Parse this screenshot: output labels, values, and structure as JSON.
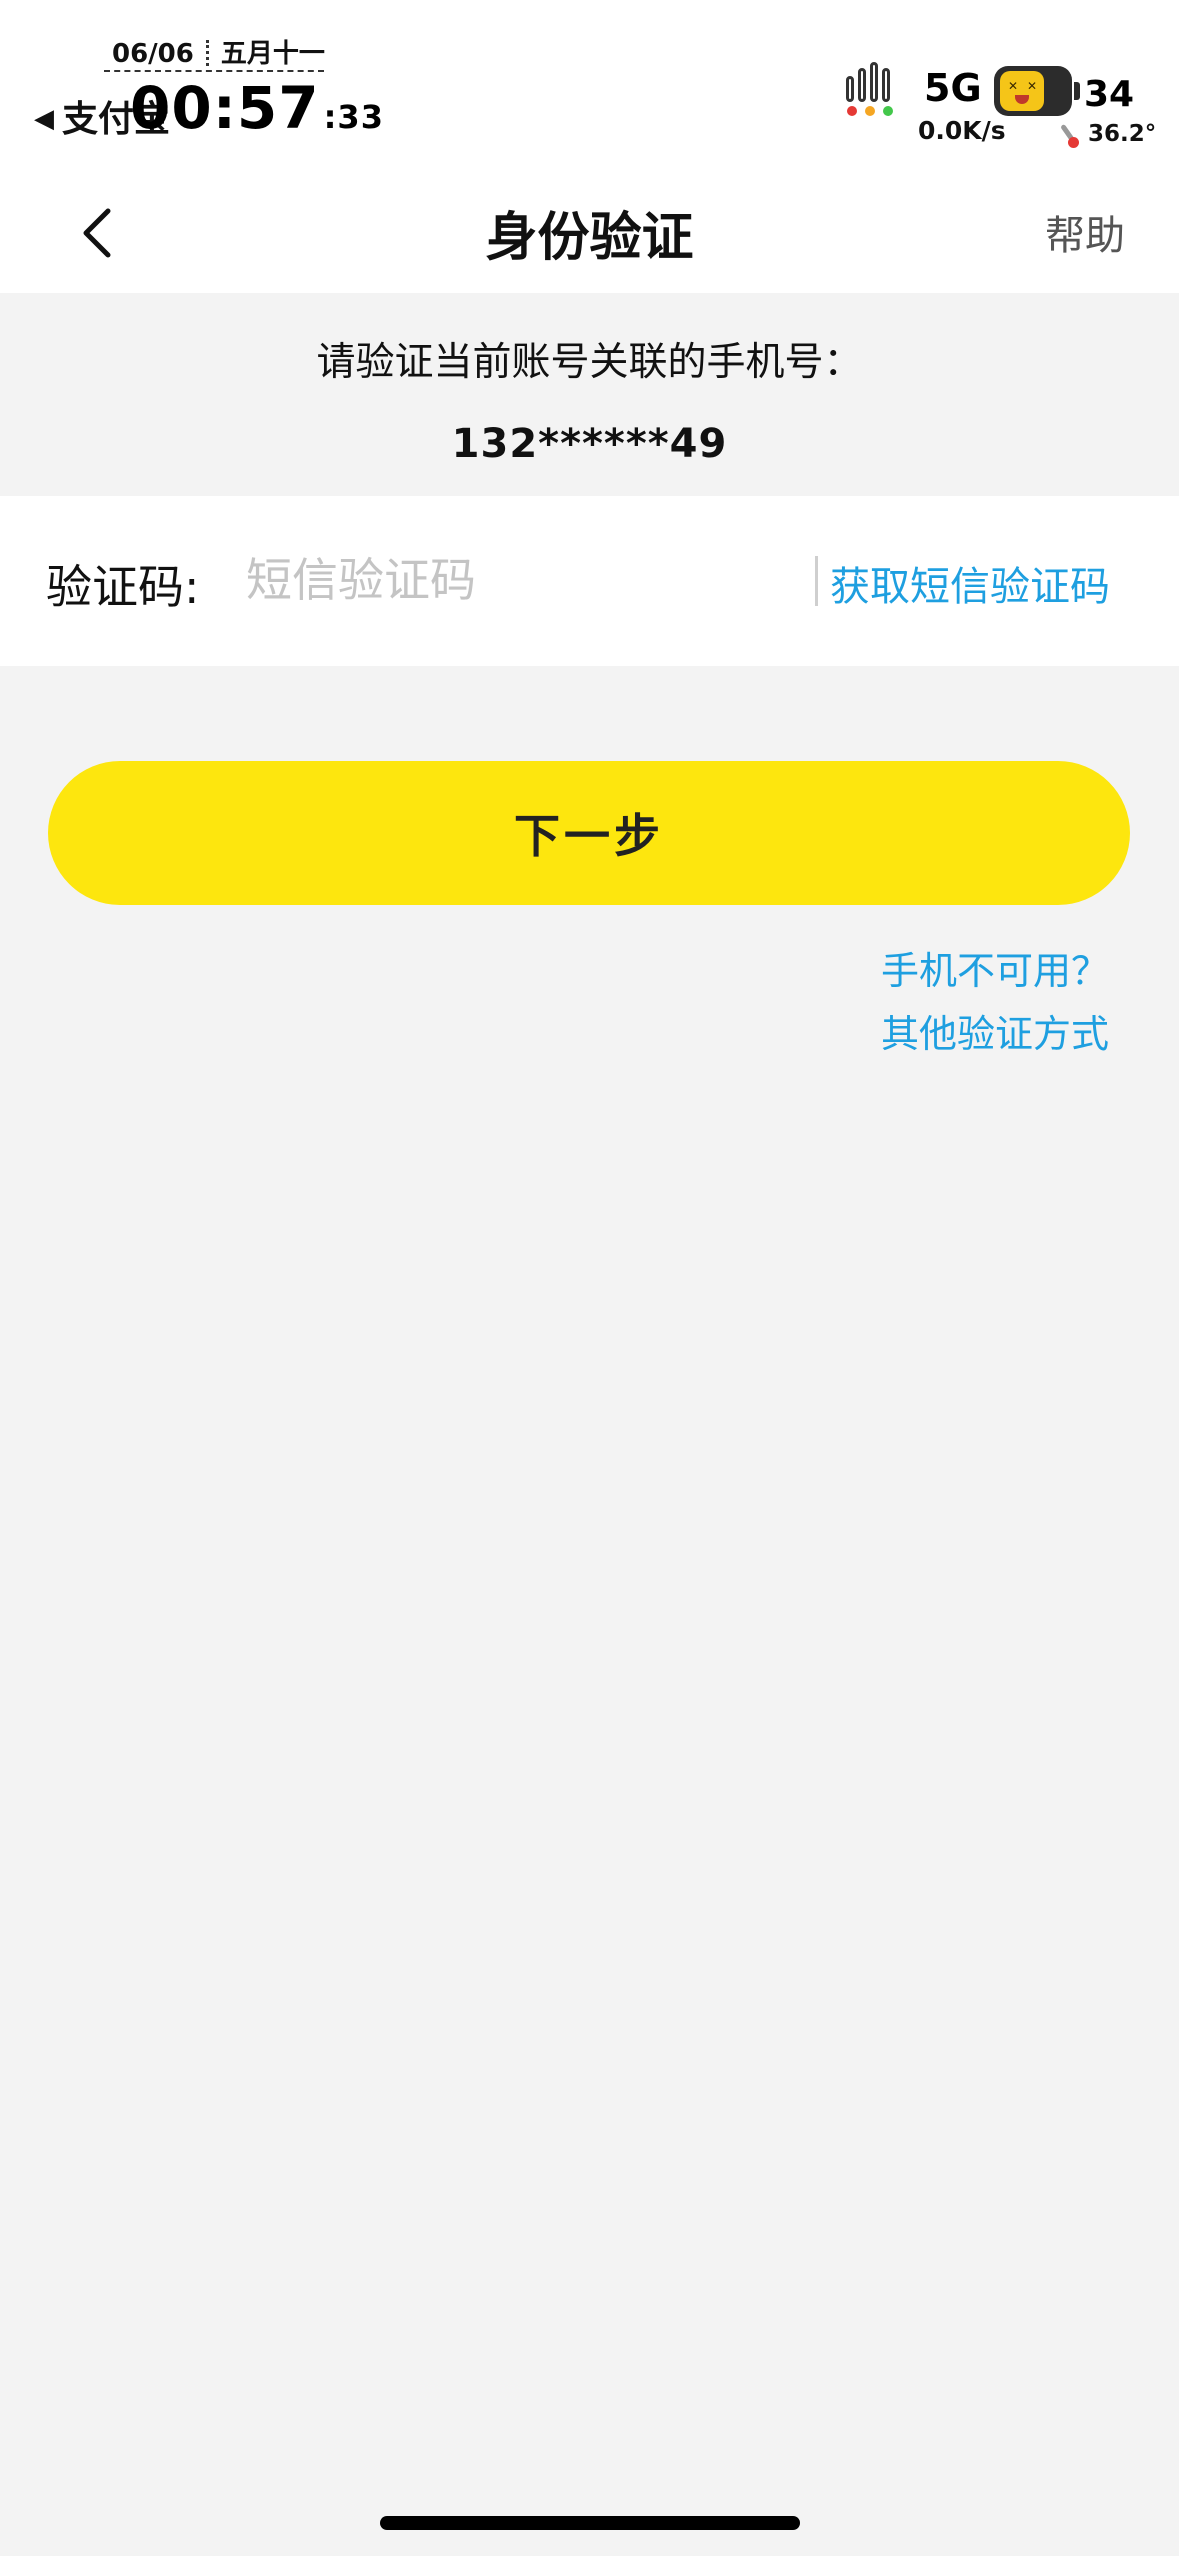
{
  "status_bar": {
    "date": "06/06",
    "lunar_date": "五月十一",
    "back_label": "支付宝",
    "time": "00:57",
    "seconds": ":33",
    "network": "5G",
    "speed": "0.0K/s",
    "battery_level": "34",
    "temperature": "36.2°",
    "signal_colors": [
      "#e53935",
      "#f5a623",
      "#43c74b"
    ]
  },
  "nav": {
    "back_icon": "chevron-left-icon",
    "title": "身份验证",
    "help_label": "帮助"
  },
  "info": {
    "prompt": "请验证当前账号关联的手机号：",
    "phone": "132******49"
  },
  "code_row": {
    "label": "验证码:",
    "value": "",
    "placeholder": "短信验证码",
    "get_code_label": "获取短信验证码"
  },
  "next_button": {
    "label": "下一步",
    "color": "#fde60e"
  },
  "alt_link": {
    "line1": "手机不可用？",
    "line2": "其他验证方式"
  },
  "colors": {
    "accent": "#1e9fe0",
    "background": "#f3f3f3"
  }
}
